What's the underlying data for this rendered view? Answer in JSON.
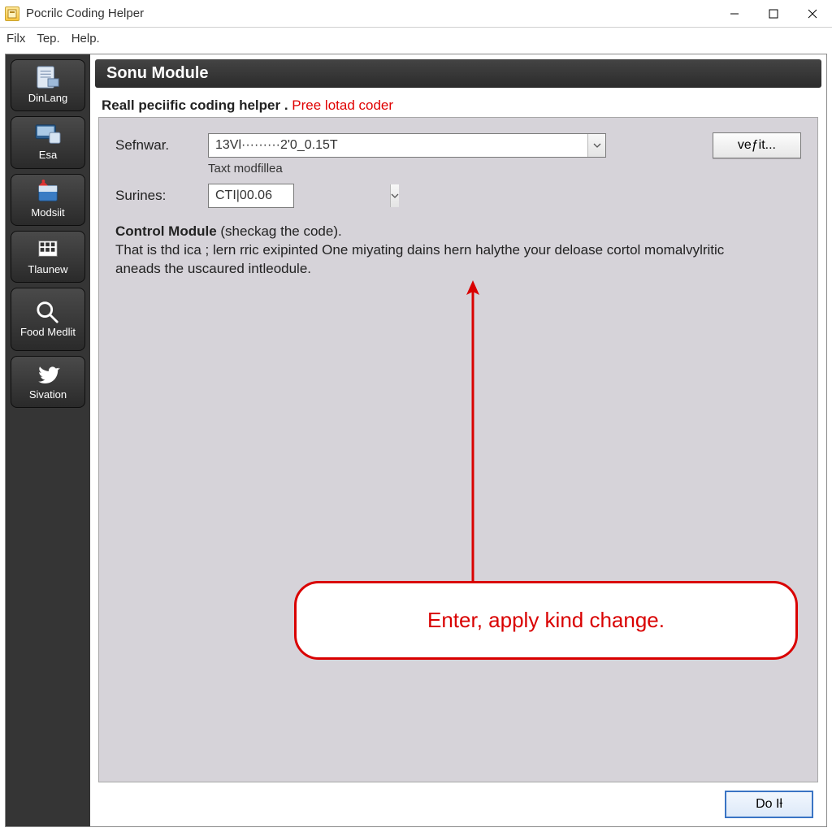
{
  "window": {
    "title": "Pocrilc Coding Helper"
  },
  "menu": {
    "file": "Filx",
    "edit": "Tep.",
    "help": "Help."
  },
  "sidebar": {
    "items": [
      {
        "label": "DinLang",
        "icon": "document-icon"
      },
      {
        "label": "Esa",
        "icon": "monitor-icon"
      },
      {
        "label": "Modsiit",
        "icon": "package-icon"
      },
      {
        "label": "Tlaunew",
        "icon": "grid-icon"
      },
      {
        "label": "Food Medlit",
        "icon": "search-icon"
      },
      {
        "label": "Sivation",
        "icon": "bird-icon"
      }
    ]
  },
  "module": {
    "title": "Sonu Module",
    "subtitle_bold": "Reall peciific coding helper .",
    "subtitle_red": "Pree lotad coder"
  },
  "form": {
    "field1": {
      "label": "Sefnwar.",
      "value": "13Vl·········2'0_0.15T",
      "note": "Taxt modfillea"
    },
    "field2": {
      "label": "Surines:",
      "value": "CTI|00.06"
    },
    "verify_btn": "veƒit..."
  },
  "desc": {
    "bold": "Control Module",
    "paren": "(sheckag the code).",
    "body": "That is thd ica ; lern rric exipinted One miyating dains hern halythe your deloase cortol momalvylritic aneads the uscaured intleodule."
  },
  "callout": {
    "text": "Enter, apply kind change."
  },
  "bottom": {
    "do_btn": "Do Iƚ"
  }
}
